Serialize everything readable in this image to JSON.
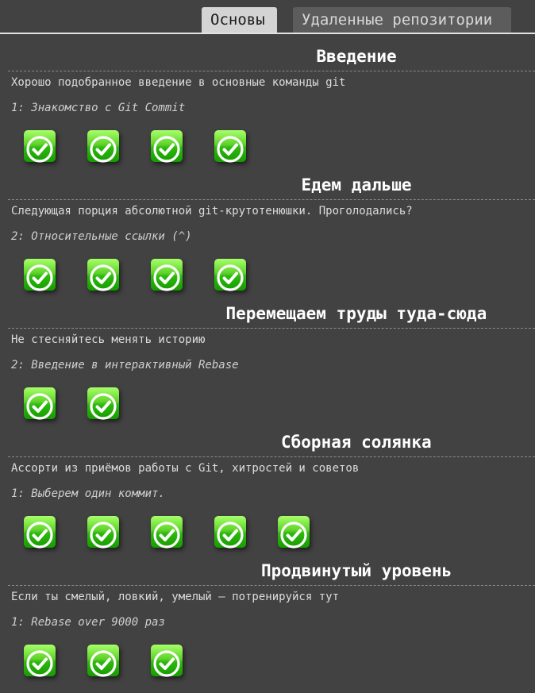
{
  "tabs": [
    {
      "label": "Основы",
      "active": true
    },
    {
      "label": "Удаленные репозитории",
      "active": false
    }
  ],
  "colors": {
    "background": "#424242",
    "tab_active": "#d4d4d4",
    "tab_inactive": "#5c5c5c",
    "level_complete": "#2db80e"
  },
  "sequences": [
    {
      "title": "Введение",
      "about": "Хорошо подобранное введение в основные команды git",
      "current_level": "1: Знакомство с Git Commit",
      "levels_completed": 4,
      "level_icon": "checkmark-icon"
    },
    {
      "title": "Едем дальше",
      "about": "Следующая порция абсолютной git-крутотенюшки. Проголодались?",
      "current_level": "2: Относительные ссылки (^)",
      "levels_completed": 4,
      "level_icon": "checkmark-icon"
    },
    {
      "title": "Перемещаем труды туда-сюда",
      "about": "Не стесняйтесь менять историю",
      "current_level": "2: Введение в интерактивный Rebase",
      "levels_completed": 2,
      "level_icon": "checkmark-icon"
    },
    {
      "title": "Сборная солянка",
      "about": "Ассорти из приёмов работы с Git, хитростей и советов",
      "current_level": "1: Выберем один коммит.",
      "levels_completed": 5,
      "level_icon": "checkmark-icon"
    },
    {
      "title": "Продвинутый уровень",
      "about": "Если ты смелый, ловкий, умелый — потренируйся тут",
      "current_level": "1: Rebase over 9000 раз",
      "levels_completed": 3,
      "level_icon": "checkmark-icon"
    }
  ]
}
